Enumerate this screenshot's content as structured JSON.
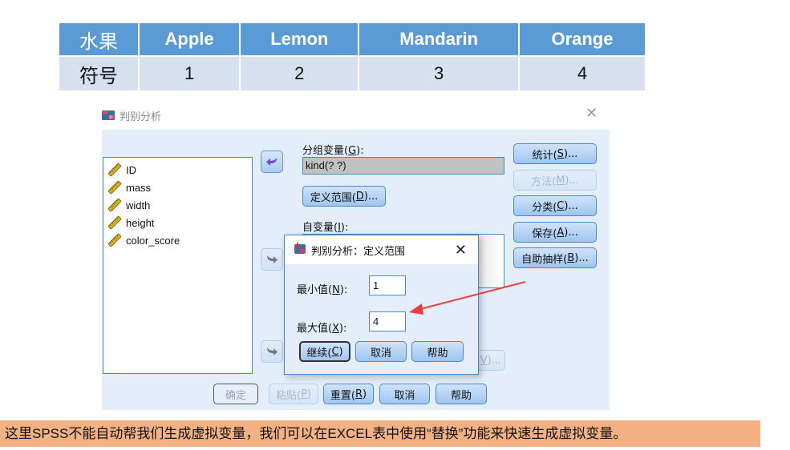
{
  "fruit_table": {
    "header_label": "水果",
    "fruits": [
      "Apple",
      "Lemon",
      "Mandarin",
      "Orange"
    ],
    "code_label": "符号",
    "codes": [
      "1",
      "2",
      "3",
      "4"
    ],
    "colors": {
      "header_bg": "#5b9bd5",
      "row_bg": "#d6e0ee"
    }
  },
  "main_dialog": {
    "title": "判别分析",
    "variables": [
      "ID",
      "mass",
      "width",
      "height",
      "color_score"
    ],
    "grouping_label": "分组变量(",
    "grouping_key": "G",
    "grouping_label_end": "):",
    "grouping_value": "kind(? ?)",
    "define_range_button": {
      "text": "定义范围(",
      "key": "D",
      "end": ")..."
    },
    "independent_label": "自变量(",
    "independent_key": "I",
    "independent_label_end": "):",
    "side_buttons": [
      {
        "text": "统计(",
        "key": "S",
        "end": ")...",
        "enabled": true
      },
      {
        "text": "方法(",
        "key": "M",
        "end": ")...",
        "enabled": false
      },
      {
        "text": "分类(",
        "key": "C",
        "end": ")...",
        "enabled": true
      },
      {
        "text": "保存(",
        "key": "A",
        "end": ")...",
        "enabled": true
      },
      {
        "text": "自助抽样(",
        "key": "B",
        "end": ")...",
        "enabled": true
      }
    ],
    "hidden_button_partial": {
      "key": "V",
      "end": ")..."
    },
    "bottom_buttons": {
      "ok": "确定",
      "paste": "粘贴(",
      "paste_key": "P",
      "reset": "重置(",
      "reset_key": "R",
      "cancel": "取消",
      "help": "帮助"
    }
  },
  "range_dialog": {
    "title": "判别分析：定义范围",
    "min_label": "最小值(",
    "min_key": "N",
    "min_value": "1",
    "max_label": "最大值(",
    "max_key": "X",
    "max_value": "4",
    "label_end": "):",
    "continue_label": "继续(",
    "continue_key": "C",
    "cancel_label": "取消",
    "help_label": "帮助"
  },
  "note": {
    "text": "这里SPSS不能自动帮我们生成虚拟变量，我们可以在EXCEL表中使用“替换”功能来快速生成虚拟变量。",
    "bg": "#f4b183"
  },
  "annotation": {
    "arrow_color": "#e8403f"
  }
}
